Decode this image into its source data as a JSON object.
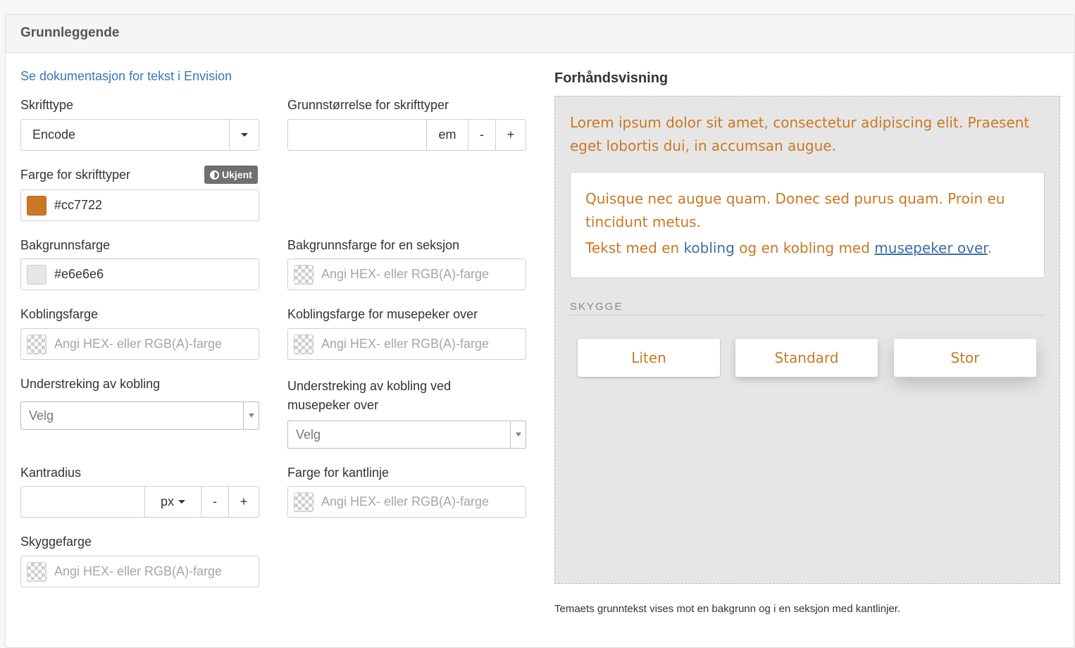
{
  "panel": {
    "title": "Grunnleggende"
  },
  "doc_link": "Se dokumentasjon for tekst i Envision",
  "colors": {
    "text": "#cc7722",
    "background": "#e6e6e6",
    "link": "#3a6ea5",
    "accent": "#3a78b5"
  },
  "fields": {
    "font_type": {
      "label": "Skrifttype",
      "value": "Encode"
    },
    "base_size": {
      "label": "Grunnstørrelse for skrifttyper",
      "value": "",
      "unit": "em",
      "minus": "-",
      "plus": "+"
    },
    "font_color": {
      "label": "Farge for skrifttyper",
      "value": "#cc7722",
      "badge": "Ukjent"
    },
    "bg_color": {
      "label": "Bakgrunnsfarge",
      "value": "#e6e6e6"
    },
    "section_bg_color": {
      "label": "Bakgrunnsfarge for en seksjon",
      "placeholder": "Angi HEX- eller RGB(A)-farge"
    },
    "link_color": {
      "label": "Koblingsfarge",
      "placeholder": "Angi HEX- eller RGB(A)-farge"
    },
    "link_hover_color": {
      "label": "Koblingsfarge for musepeker over",
      "placeholder": "Angi HEX- eller RGB(A)-farge"
    },
    "link_underline": {
      "label": "Understreking av kobling",
      "value": "Velg"
    },
    "link_hover_underline": {
      "label_line1": "Understreking av kobling ved",
      "label_line2": "musepeker over",
      "value": "Velg"
    },
    "border_radius": {
      "label": "Kantradius",
      "value": "",
      "unit": "px",
      "minus": "-",
      "plus": "+"
    },
    "border_color": {
      "label": "Farge for kantlinje",
      "placeholder": "Angi HEX- eller RGB(A)-farge"
    },
    "shadow_color": {
      "label": "Skyggefarge",
      "placeholder": "Angi HEX- eller RGB(A)-farge"
    }
  },
  "preview": {
    "title": "Forhåndsvisning",
    "text": "Lorem ipsum dolor sit amet, consectetur adipiscing elit. Praesent eget lobortis dui, in accumsan augue.",
    "section_text": "Quisque nec augue quam. Donec sed purus quam. Proin eu tincidunt metus.",
    "link_line": {
      "prefix": "Tekst med en ",
      "link": "kobling",
      "middle": " og en kobling med ",
      "hover_link": "musepeker over",
      "suffix": "."
    },
    "shadow_label": "SKYGGE",
    "shadow_buttons": [
      "Liten",
      "Standard",
      "Stor"
    ],
    "footnote": "Temaets grunntekst vises mot en bakgrunn og i en seksjon med kantlinjer."
  }
}
